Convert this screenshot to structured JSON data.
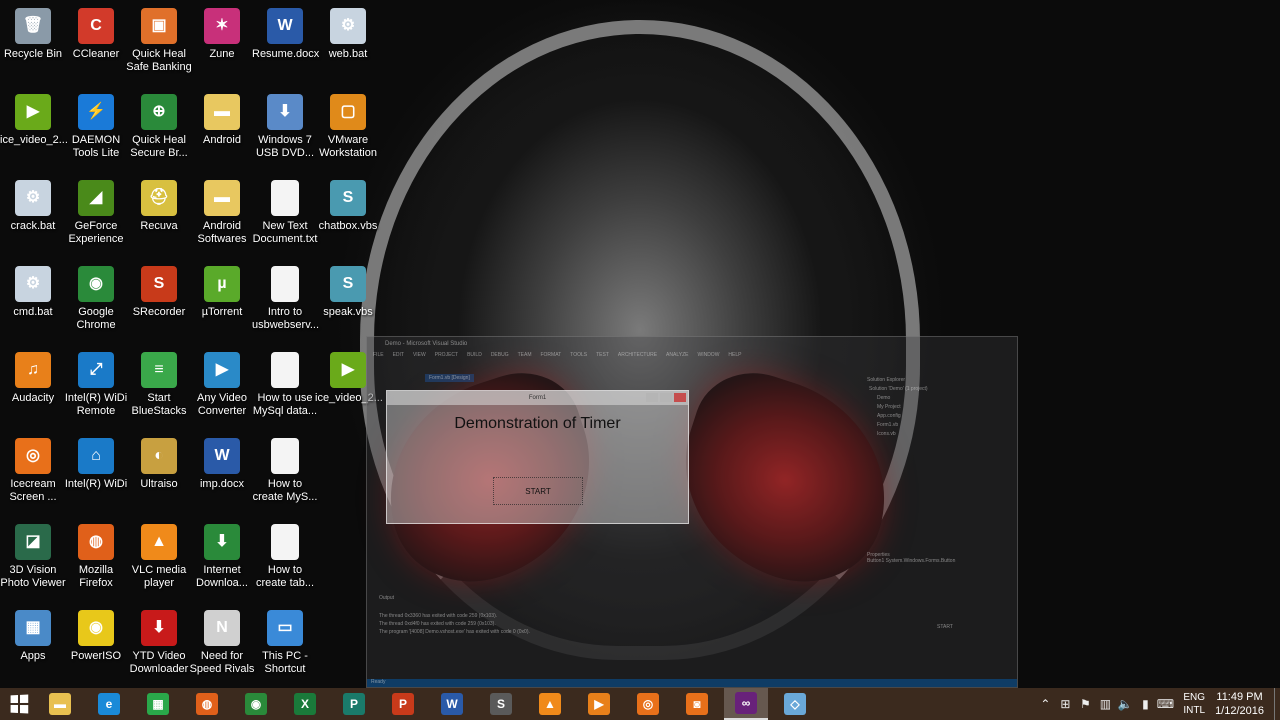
{
  "desktop": {
    "icons": [
      {
        "label": "Recycle Bin",
        "icon": "recycle-bin-icon",
        "color": "#8a9aa8",
        "glyph": "🗑"
      },
      {
        "label": "CCleaner",
        "icon": "ccleaner-icon",
        "color": "#d23a2a",
        "glyph": "C"
      },
      {
        "label": "Quick Heal Safe Banking",
        "icon": "quickheal-banking-icon",
        "color": "#e0702a",
        "glyph": "▣"
      },
      {
        "label": "Zune",
        "icon": "zune-icon",
        "color": "#c8307a",
        "glyph": "✶"
      },
      {
        "label": "Resume.docx",
        "icon": "word-doc-icon",
        "color": "#2a5aa8",
        "glyph": "W"
      },
      {
        "label": "web.bat",
        "icon": "bat-file-icon",
        "color": "#c8d4e0",
        "glyph": "⚙"
      },
      {
        "label": "ice_video_2...",
        "icon": "video-file-icon",
        "color": "#6aaa1a",
        "glyph": "▶"
      },
      {
        "label": "DAEMON Tools Lite",
        "icon": "daemon-tools-icon",
        "color": "#1a7ad8",
        "glyph": "⚡"
      },
      {
        "label": "Quick Heal Secure Br...",
        "icon": "quickheal-browser-icon",
        "color": "#2a8a3a",
        "glyph": "⊕"
      },
      {
        "label": "Android",
        "icon": "folder-icon",
        "color": "#e8c860",
        "glyph": "▬"
      },
      {
        "label": "Windows 7 USB DVD...",
        "icon": "usb-dvd-tool-icon",
        "color": "#5a8ac8",
        "glyph": "⬇"
      },
      {
        "label": "VMware Workstation",
        "icon": "vmware-icon",
        "color": "#e08a1a",
        "glyph": "▢"
      },
      {
        "label": "crack.bat",
        "icon": "bat-file-icon",
        "color": "#c8d4e0",
        "glyph": "⚙"
      },
      {
        "label": "GeForce Experience",
        "icon": "geforce-icon",
        "color": "#4a8a1a",
        "glyph": "◢"
      },
      {
        "label": "Recuva",
        "icon": "recuva-icon",
        "color": "#d8c040",
        "glyph": "⛑"
      },
      {
        "label": "Android Softwares",
        "icon": "folder-icon",
        "color": "#e8c860",
        "glyph": "▬"
      },
      {
        "label": "New Text Document.txt",
        "icon": "text-file-icon",
        "color": "#f4f4f4",
        "glyph": ""
      },
      {
        "label": "chatbox.vbs",
        "icon": "vbs-script-icon",
        "color": "#4a9ab0",
        "glyph": "S"
      },
      {
        "label": "cmd.bat",
        "icon": "bat-file-icon",
        "color": "#c8d4e0",
        "glyph": "⚙"
      },
      {
        "label": "Google Chrome",
        "icon": "chrome-icon",
        "color": "#2a8a3a",
        "glyph": "◉"
      },
      {
        "label": "SRecorder",
        "icon": "srecorder-icon",
        "color": "#c83a1a",
        "glyph": "S"
      },
      {
        "label": "µTorrent",
        "icon": "utorrent-icon",
        "color": "#5aaa2a",
        "glyph": "µ"
      },
      {
        "label": "Intro to usbwebserv...",
        "icon": "text-file-icon",
        "color": "#f4f4f4",
        "glyph": ""
      },
      {
        "label": "speak.vbs",
        "icon": "vbs-script-icon",
        "color": "#4a9ab0",
        "glyph": "S"
      },
      {
        "label": "Audacity",
        "icon": "audacity-icon",
        "color": "#e8801a",
        "glyph": "♫"
      },
      {
        "label": "Intel(R) WiDi Remote",
        "icon": "intel-widi-icon",
        "color": "#1a7ac8",
        "glyph": "⤢"
      },
      {
        "label": "Start BlueStacks",
        "icon": "bluestacks-icon",
        "color": "#3aa84a",
        "glyph": "≡"
      },
      {
        "label": "Any Video Converter",
        "icon": "video-converter-icon",
        "color": "#2a8ac8",
        "glyph": "▶"
      },
      {
        "label": "How to use MySql data...",
        "icon": "text-file-icon",
        "color": "#f4f4f4",
        "glyph": ""
      },
      {
        "label": "ice_video_2...",
        "icon": "video-file-icon",
        "color": "#6aaa1a",
        "glyph": "▶"
      },
      {
        "label": "Icecream Screen ...",
        "icon": "icecream-recorder-icon",
        "color": "#e8701a",
        "glyph": "◎"
      },
      {
        "label": "Intel(R) WiDi",
        "icon": "intel-widi-icon",
        "color": "#1a7ac8",
        "glyph": "⌂"
      },
      {
        "label": "Ultraiso",
        "icon": "ultraiso-icon",
        "color": "#c8a040",
        "glyph": "◐"
      },
      {
        "label": "imp.docx",
        "icon": "word-doc-icon",
        "color": "#2a5aa8",
        "glyph": "W"
      },
      {
        "label": "How to create MyS...",
        "icon": "text-file-icon",
        "color": "#f4f4f4",
        "glyph": ""
      },
      {
        "label": "3D Vision Photo Viewer",
        "icon": "3d-vision-icon",
        "color": "#2a6a4a",
        "glyph": "◪"
      },
      {
        "label": "Mozilla Firefox",
        "icon": "firefox-icon",
        "color": "#e0601a",
        "glyph": "◍"
      },
      {
        "label": "VLC media player",
        "icon": "vlc-icon",
        "color": "#f08a1a",
        "glyph": "▲"
      },
      {
        "label": "Internet Downloa...",
        "icon": "idm-icon",
        "color": "#2a8a3a",
        "glyph": "⬇"
      },
      {
        "label": "How to create tab...",
        "icon": "text-file-icon",
        "color": "#f4f4f4",
        "glyph": ""
      },
      {
        "label": "Apps",
        "icon": "apps-icon",
        "color": "#4a8ac8",
        "glyph": "▦"
      },
      {
        "label": "PowerISO",
        "icon": "poweriso-icon",
        "color": "#e8c81a",
        "glyph": "◉"
      },
      {
        "label": "YTD Video Downloader",
        "icon": "ytd-icon",
        "color": "#c81a1a",
        "glyph": "⬇"
      },
      {
        "label": "Need for Speed Rivals",
        "icon": "nfs-icon",
        "color": "#d0d0d0",
        "glyph": "N"
      },
      {
        "label": "This PC - Shortcut",
        "icon": "this-pc-icon",
        "color": "#3a8ad8",
        "glyph": "▭"
      }
    ]
  },
  "visual_studio": {
    "title": "Demo - Microsoft Visual Studio",
    "menu": [
      "FILE",
      "EDIT",
      "VIEW",
      "PROJECT",
      "BUILD",
      "DEBUG",
      "TEAM",
      "FORMAT",
      "TOOLS",
      "TEST",
      "ARCHITECTURE",
      "ANALYZE",
      "WINDOW",
      "HELP"
    ],
    "doc_tab": "Form1.vb [Design]",
    "solution_explorer_title": "Solution Explorer",
    "solution_items": [
      "Solution 'Demo' (1 project)",
      "Demo",
      "My Project",
      "App.config",
      "Form1.vb",
      "Icons.vb"
    ],
    "properties_title": "Properties",
    "properties_object": "Button1 System.Windows.Forms.Button",
    "properties_text_value": "START",
    "output_title": "Output",
    "output_lines": [
      "The thread 0x3360 has exited with code 259 (0x103).",
      "The thread 0xd4f0 has exited with code 259 (0x103).",
      "The program '[4008] Demo.vshost.exe' has exited with code 0 (0x0)."
    ],
    "status_text": "Ready"
  },
  "form1": {
    "title": "Form1",
    "label_text": "Demonstration of Timer",
    "button_text": "START"
  },
  "taskbar": {
    "apps": [
      {
        "name": "file-explorer",
        "icon": "file-explorer-icon",
        "color": "#e8c050",
        "glyph": "▬",
        "active": false
      },
      {
        "name": "internet-explorer",
        "icon": "internet-explorer-icon",
        "color": "#1a8ad8",
        "glyph": "e",
        "active": false
      },
      {
        "name": "store",
        "icon": "store-icon",
        "color": "#2aa84a",
        "glyph": "▦",
        "active": false
      },
      {
        "name": "firefox",
        "icon": "firefox-icon",
        "color": "#e0601a",
        "glyph": "◍",
        "active": false
      },
      {
        "name": "chrome",
        "icon": "chrome-icon",
        "color": "#2a8a3a",
        "glyph": "◉",
        "active": false
      },
      {
        "name": "excel",
        "icon": "excel-icon",
        "color": "#1a7a3a",
        "glyph": "X",
        "active": false
      },
      {
        "name": "publisher",
        "icon": "publisher-icon",
        "color": "#1a7a6a",
        "glyph": "P",
        "active": false
      },
      {
        "name": "powerpoint",
        "icon": "powerpoint-icon",
        "color": "#c83a1a",
        "glyph": "P",
        "active": false
      },
      {
        "name": "word",
        "icon": "word-icon",
        "color": "#2a5aa8",
        "glyph": "W",
        "active": false
      },
      {
        "name": "sublime",
        "icon": "sublime-icon",
        "color": "#5a5a5a",
        "glyph": "S",
        "active": false
      },
      {
        "name": "vlc",
        "icon": "vlc-icon",
        "color": "#f08a1a",
        "glyph": "▲",
        "active": false
      },
      {
        "name": "video-player",
        "icon": "video-player-icon",
        "color": "#e8801a",
        "glyph": "▶",
        "active": false
      },
      {
        "name": "icecream-recorder",
        "icon": "icecream-recorder-icon",
        "color": "#e8701a",
        "glyph": "◎",
        "active": false
      },
      {
        "name": "screenshot-tool",
        "icon": "camera-icon",
        "color": "#e8701a",
        "glyph": "◙",
        "active": false
      },
      {
        "name": "visual-studio",
        "icon": "visual-studio-icon",
        "color": "#68217a",
        "glyph": "∞",
        "active": true
      },
      {
        "name": "virtualbox",
        "icon": "virtual-machine-icon",
        "color": "#6aa8d8",
        "glyph": "◇",
        "active": false
      }
    ],
    "lang_top": "ENG",
    "lang_bottom": "INTL",
    "time": "11:49 PM",
    "date": "1/12/2016"
  }
}
